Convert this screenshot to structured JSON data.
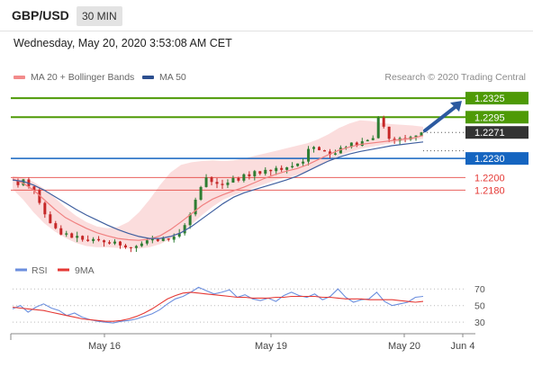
{
  "header": {
    "symbol": "GBP/USD",
    "timeframe": "30 MIN"
  },
  "datetime": "Wednesday, May 20, 2020 3:53:08 AM CET",
  "legend": {
    "ma20_bb": "MA 20 + Bollinger Bands",
    "ma50": "MA 50",
    "credit": "Research © 2020 Trading Central"
  },
  "colors": {
    "resistance": "#4e9a06",
    "support": "#1565c0",
    "target_red": "#e53935",
    "bull_candle": "#2e7d32",
    "bear_candle": "#c62828",
    "bollinger_fill": "#f9d2d2",
    "ma20": "#f08080",
    "ma50": "#3f5f9f",
    "rsi": "#6b8ede",
    "rsi_9ma": "#e53935",
    "price_label_bg": "#333333",
    "arrow": "#2c5aa0"
  },
  "chart_data": [
    {
      "type": "candlestick",
      "symbol": "GBP/USD",
      "timeframe": "30 MIN",
      "ylim": [
        1.208,
        1.2345
      ],
      "x_ticks": [
        "May 16",
        "May 19",
        "May 20",
        "Jun 4"
      ],
      "levels": [
        {
          "value": 1.2325,
          "label": "1.2325",
          "kind": "resistance"
        },
        {
          "value": 1.2295,
          "label": "1.2295",
          "kind": "resistance"
        },
        {
          "value": 1.2271,
          "label": "1.2271",
          "kind": "current"
        },
        {
          "value": 1.223,
          "label": "1.2230",
          "kind": "support"
        },
        {
          "value": 1.22,
          "label": "1.2200",
          "kind": "target"
        },
        {
          "value": 1.218,
          "label": "1.2180",
          "kind": "target"
        }
      ],
      "price_path": [
        1.2195,
        1.2188,
        1.2197,
        1.2186,
        1.218,
        1.216,
        1.2142,
        1.2128,
        1.212,
        1.211,
        1.2112,
        1.2105,
        1.2108,
        1.2102,
        1.21,
        1.2103,
        1.2101,
        1.2098,
        1.2096,
        1.2099,
        1.2093,
        1.209,
        1.2089,
        1.2092,
        1.2096,
        1.2101,
        1.2103,
        1.21,
        1.2104,
        1.2102,
        1.2107,
        1.2112,
        1.2125,
        1.2142,
        1.2165,
        1.2185,
        1.22,
        1.2193,
        1.219,
        1.2188,
        1.2192,
        1.2199,
        1.2195,
        1.2205,
        1.2202,
        1.221,
        1.2206,
        1.2212,
        1.221,
        1.2215,
        1.2212,
        1.2216,
        1.2218,
        1.2222,
        1.2225,
        1.2245,
        1.2248,
        1.2243,
        1.2241,
        1.2236,
        1.2238,
        1.2247,
        1.2248,
        1.2255,
        1.225,
        1.2257,
        1.2259,
        1.2262,
        1.2294,
        1.228,
        1.2261,
        1.2258,
        1.2262,
        1.226,
        1.2264,
        1.2266,
        1.2271
      ],
      "ma20": [
        1.2198,
        1.2191,
        1.218,
        1.2165,
        1.215,
        1.2137,
        1.2128,
        1.212,
        1.2113,
        1.2108,
        1.2104,
        1.2102,
        1.2101,
        1.2103,
        1.2108,
        1.2118,
        1.213,
        1.2143,
        1.2156,
        1.2166,
        1.2173,
        1.2179,
        1.2185,
        1.2192,
        1.2199,
        1.2205,
        1.221,
        1.2214,
        1.222,
        1.2228,
        1.2236,
        1.2243,
        1.2248,
        1.2252,
        1.2254,
        1.2256,
        1.2258,
        1.226,
        1.2262,
        1.2266
      ],
      "ma50": [
        1.2196,
        1.2194,
        1.2188,
        1.218,
        1.217,
        1.216,
        1.215,
        1.2141,
        1.2133,
        1.2125,
        1.2118,
        1.2112,
        1.2107,
        1.2104,
        1.2104,
        1.2107,
        1.2113,
        1.2123,
        1.2135,
        1.2147,
        1.2159,
        1.2169,
        1.2176,
        1.2181,
        1.2186,
        1.2191,
        1.2196,
        1.2202,
        1.221,
        1.2218,
        1.2226,
        1.2232,
        1.2237,
        1.2241,
        1.2244,
        1.2247,
        1.225,
        1.2252,
        1.2254,
        1.2256
      ],
      "bollinger_upper": [
        1.2202,
        1.22,
        1.2193,
        1.2182,
        1.2168,
        1.2153,
        1.214,
        1.213,
        1.2123,
        1.212,
        1.2122,
        1.213,
        1.2145,
        1.2165,
        1.2188,
        1.2208,
        1.222,
        1.2224,
        1.2226,
        1.2227,
        1.2226,
        1.2227,
        1.223,
        1.2234,
        1.2238,
        1.2242,
        1.2246,
        1.225,
        1.2254,
        1.226,
        1.2268,
        1.2278,
        1.2285,
        1.229,
        1.2289,
        1.2286,
        1.2284,
        1.2283,
        1.2282,
        1.228
      ],
      "bollinger_lower": [
        1.2182,
        1.2165,
        1.2145,
        1.2128,
        1.2115,
        1.2105,
        1.2097,
        1.2092,
        1.209,
        1.209,
        1.2089,
        1.2088,
        1.2088,
        1.209,
        1.2095,
        1.2103,
        1.2113,
        1.2126,
        1.2141,
        1.2154,
        1.2165,
        1.2172,
        1.2178,
        1.2184,
        1.219,
        1.2196,
        1.22,
        1.2204,
        1.221,
        1.2218,
        1.2226,
        1.2234,
        1.224,
        1.2245,
        1.2248,
        1.2251,
        1.2254,
        1.2257,
        1.2259,
        1.2261
      ]
    },
    {
      "type": "line",
      "title": "RSI",
      "series": [
        {
          "name": "RSI"
        },
        {
          "name": "9MA"
        }
      ],
      "y_ticks": [
        70,
        50,
        30
      ],
      "ylim": [
        15,
        80
      ],
      "rsi": [
        46,
        50,
        42,
        48,
        52,
        47,
        44,
        38,
        41,
        36,
        33,
        31,
        30,
        29,
        31,
        32,
        34,
        37,
        40,
        45,
        52,
        58,
        61,
        66,
        72,
        68,
        64,
        66,
        69,
        60,
        63,
        58,
        56,
        59,
        55,
        62,
        66,
        62,
        60,
        64,
        57,
        61,
        70,
        60,
        54,
        57,
        58,
        66,
        55,
        50,
        52,
        54,
        60,
        61
      ],
      "rsi_9ma": [
        48,
        47,
        46,
        45,
        44,
        42,
        40,
        38,
        36,
        34,
        33,
        32,
        31,
        31,
        32,
        34,
        37,
        41,
        46,
        52,
        58,
        62,
        65,
        66,
        65,
        64,
        63,
        62,
        61,
        60,
        60,
        59,
        59,
        59,
        60,
        60,
        61,
        61,
        61,
        61,
        60,
        60,
        59,
        58,
        58,
        58,
        57,
        57,
        57,
        57,
        56,
        55,
        54,
        55
      ]
    }
  ]
}
